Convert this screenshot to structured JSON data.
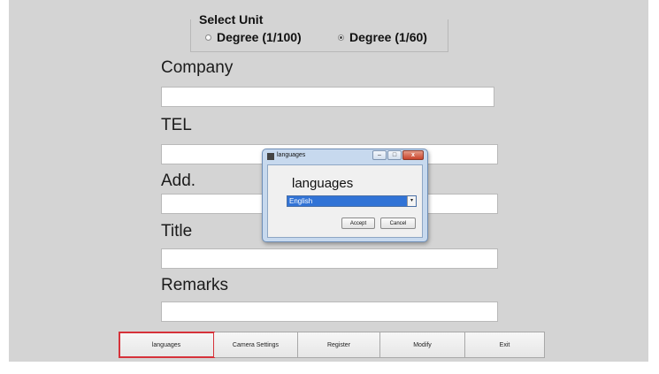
{
  "unit": {
    "title": "Select Unit",
    "options": [
      {
        "label": "Degree (1/100)",
        "selected": false
      },
      {
        "label": "Degree (1/60)",
        "selected": true
      }
    ]
  },
  "form": {
    "company_label": "Company",
    "company_value": "",
    "tel_label": "TEL",
    "tel_value": "",
    "add_label": "Add.",
    "add_value": "",
    "title_label": "Title",
    "title_value": "",
    "remarks_label": "Remarks",
    "remarks_value": ""
  },
  "buttons": {
    "languages": "languages",
    "camera_settings": "Camera Settings",
    "register": "Register",
    "modify": "Modify",
    "exit": "Exit"
  },
  "dialog": {
    "title": "languages",
    "heading": "languages",
    "selected_language": "English",
    "accept": "Accept",
    "cancel": "Cancel",
    "controls": {
      "minimize": "–",
      "maximize": "□",
      "close": "x"
    }
  },
  "colors": {
    "highlight": "#d6323a",
    "selection": "#3173d6"
  }
}
